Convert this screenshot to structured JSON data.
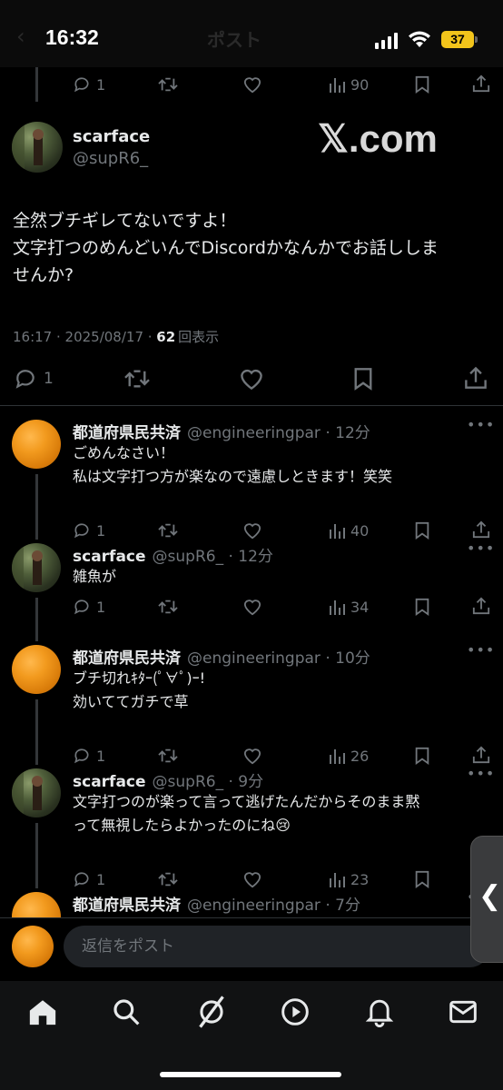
{
  "status_bar": {
    "time": "16:32",
    "battery": "37",
    "ghost_header": "ポスト"
  },
  "top_actions": {
    "replies": "1",
    "views": "90"
  },
  "main_post": {
    "name": "scarface",
    "handle": "@supR6_",
    "watermark": "𝕏.com",
    "text_line1": "全然ブチギレてないですよ！",
    "text_line2": "文字打つのめんどいんでDiscordかなんかでお話ししま",
    "text_line3": "せんか?",
    "meta_datetime": "16:17 · 2025/08/17 · ",
    "meta_views": "62",
    "meta_views_label": "回表示",
    "replies": "1"
  },
  "replies": [
    {
      "name": "都道府県民共済",
      "handle": "@engineeringpar · 12分",
      "line1": "ごめんなさい！",
      "line2": "私は文字打つ方が楽なので遠慮しときます！笑笑",
      "reply_count": "1",
      "views": "40",
      "avatar": "orange"
    },
    {
      "name": "scarface",
      "handle": "@supR6_ · 12分",
      "line1": "雑魚が",
      "line2": "",
      "reply_count": "1",
      "views": "34",
      "avatar": "photo"
    },
    {
      "name": "都道府県民共済",
      "handle": "@engineeringpar · 10分",
      "line1": "ブチ切れｷﾀｰ(ﾟ∀ﾟ)ｰ!",
      "line2": "効いててガチで草",
      "reply_count": "1",
      "views": "26",
      "avatar": "orange"
    },
    {
      "name": "scarface",
      "handle": "@supR6_ · 9分",
      "line1": "文字打つのが楽って言って逃げたんだからそのまま黙",
      "line2": "って無視したらよかったのにね😢",
      "reply_count": "1",
      "views": "23",
      "avatar": "photo"
    },
    {
      "name": "都道府県民共済",
      "handle": "@engineeringpar · 7分",
      "avatar": "orange"
    }
  ],
  "composer": {
    "placeholder": "返信をポスト"
  },
  "side_tab": {
    "glyph": "❮"
  },
  "colors": {
    "background": "#000000",
    "text": "#e7e9ea",
    "muted": "#71767b",
    "divider": "#2f3336"
  },
  "icons": [
    "reply-icon",
    "retweet-icon",
    "like-icon",
    "views-icon",
    "bookmark-icon",
    "share-icon",
    "home-icon",
    "search-icon",
    "grok-icon",
    "video-icon",
    "notifications-icon",
    "messages-icon"
  ]
}
